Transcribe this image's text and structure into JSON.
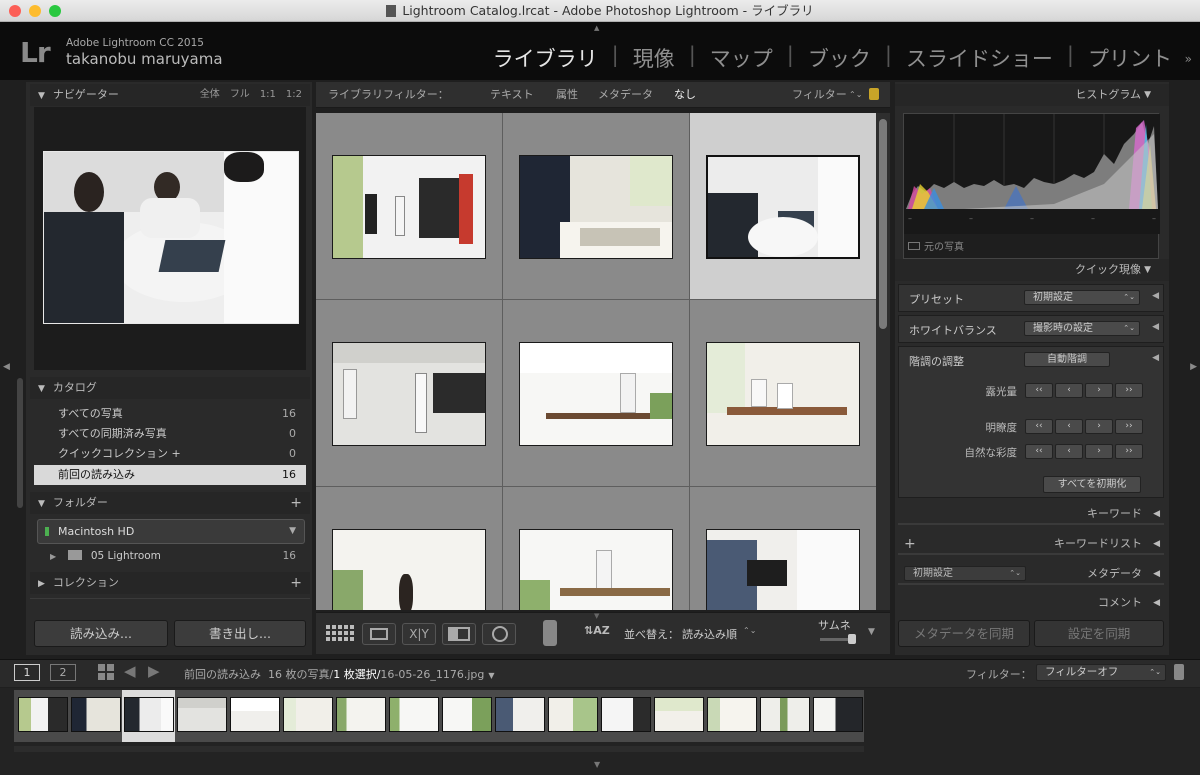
{
  "window": {
    "title": "Lightroom Catalog.lrcat - Adobe Photoshop Lightroom - ライブラリ"
  },
  "identity": {
    "logo": "Lr",
    "app": "Adobe Lightroom CC 2015",
    "user": "takanobu maruyama"
  },
  "modules": [
    {
      "label": "ライブラリ"
    },
    {
      "label": "現像"
    },
    {
      "label": "マップ"
    },
    {
      "label": "ブック"
    },
    {
      "label": "スライドショー"
    },
    {
      "label": "プリント"
    }
  ],
  "module_sep": "|",
  "navigator": {
    "title": "ナビゲーター",
    "zoom": [
      "全体",
      "フル",
      "1:1",
      "1:2"
    ]
  },
  "catalog": {
    "title": "カタログ",
    "items": [
      {
        "label": "すべての写真",
        "count": "16"
      },
      {
        "label": "すべての同期済み写真",
        "count": "0"
      },
      {
        "label": "クイックコレクション +",
        "count": "0"
      },
      {
        "label": "前回の読み込み",
        "count": "16"
      }
    ]
  },
  "folders": {
    "title": "フォルダー",
    "add": "+",
    "volume": "Macintosh HD",
    "folder": "05 Lightroom",
    "folder_count": "16"
  },
  "collections": {
    "title": "コレクション",
    "add": "+"
  },
  "left_buttons": {
    "import": "読み込み...",
    "export": "書き出し..."
  },
  "filter_bar": {
    "label": "ライブラリフィルター：",
    "tabs": [
      "テキスト",
      "属性",
      "メタデータ",
      "なし"
    ],
    "preset": "フィルター"
  },
  "toolbar": {
    "sort_label": "並べ替え：",
    "sort_value": "読み込み順",
    "thumb_label": "サムネ"
  },
  "right": {
    "histogram": "ヒストグラム",
    "original_photo": "元の写真",
    "quick_develop": "クイック現像",
    "preset_label": "プリセット",
    "preset_value": "初期設定",
    "wb_label": "ホワイトバランス",
    "wb_value": "撮影時の設定",
    "tone_label": "階調の調整",
    "auto_tone": "自動階調",
    "exposure": "露光量",
    "clarity": "明瞭度",
    "vibrance": "自然な彩度",
    "reset_all": "すべてを初期化",
    "keywording": "キーワード",
    "keyword_list": "キーワードリスト",
    "metadata": "メタデータ",
    "metadata_preset": "初期設定",
    "comments": "コメント",
    "sync_metadata": "メタデータを同期",
    "sync_settings": "設定を同期"
  },
  "filmstrip_bar": {
    "screen1": "1",
    "screen2": "2",
    "source": "前回の読み込み",
    "count_text": "16 枚の写真/",
    "selected_text": "1 枚選択/",
    "filename": "16-05-26_1176.jpg",
    "filter_label": "フィルター：",
    "filter_value": "フィルターオフ"
  },
  "colors": {
    "accent": "#e6e6e6",
    "panel": "#2a2a2a",
    "grid": "#7c7c7c",
    "selected_cell": "#cfcfcf"
  },
  "icons": [
    "grid-view-icon",
    "loupe-view-icon",
    "compare-view-icon",
    "survey-view-icon",
    "people-view-icon",
    "spray-can-icon",
    "sort-az-icon",
    "lock-icon"
  ]
}
